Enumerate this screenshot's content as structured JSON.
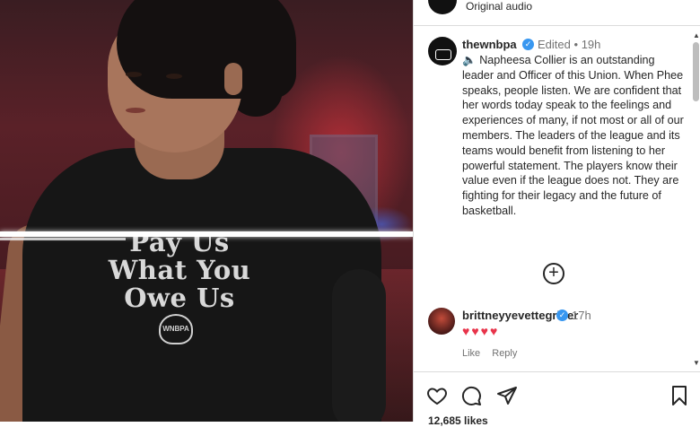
{
  "media": {
    "shirt_lines": [
      "Pay Us",
      "What You",
      "Owe Us"
    ],
    "shirt_logo": "WNBPA"
  },
  "top": {
    "audio_label": "Original audio"
  },
  "post": {
    "username": "thewnbpa",
    "edited": "Edited",
    "time": "19h",
    "caption": "Napheesa Collier is an outstanding leader and Officer of this Union. When Phee speaks, people listen. We are confident that her words today speak to the feelings and experiences of many, if not most or all of our members. The leaders of the league and its teams would benefit from listening to her powerful statement. The players know their value even if the league does not. They are fighting for their legacy and the future of basketball.",
    "separator": "•"
  },
  "comment": {
    "username": "brittneyyevettegriner",
    "time": "17h",
    "hearts": "♥♥♥♥",
    "like_label": "Like",
    "reply_label": "Reply"
  },
  "footer": {
    "likes": "12,685 likes"
  },
  "colors": {
    "verified": "#3897f0",
    "heart": "#e8334a"
  }
}
